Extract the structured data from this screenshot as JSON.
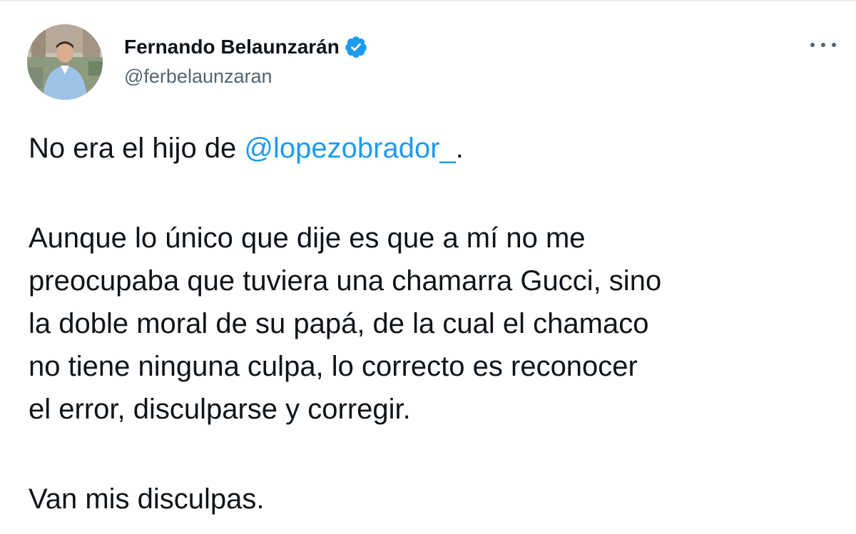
{
  "author": {
    "display_name": "Fernando Belaunzarán",
    "handle": "@ferbelaunzaran",
    "verified_icon": "verified-badge-icon",
    "avatar": "profile-photo"
  },
  "more_icon": "more-options-icon",
  "tweet": {
    "p1_prefix": "No era el hijo de ",
    "p1_mention": "@lopezobrador_",
    "p1_suffix": ".",
    "p2_lines": [
      "Aunque lo único que dije es que a mí no me",
      "preocupaba que tuviera una chamarra Gucci, sino",
      "la doble moral de su papá, de la cual el chamaco",
      "no tiene ninguna culpa, lo correcto es reconocer",
      "el error, disculparse y corregir."
    ],
    "p3": "Van mis disculpas."
  },
  "colors": {
    "text": "#0f1419",
    "secondary": "#536471",
    "link": "#1d9bf0",
    "verified": "#1d9bf0"
  }
}
